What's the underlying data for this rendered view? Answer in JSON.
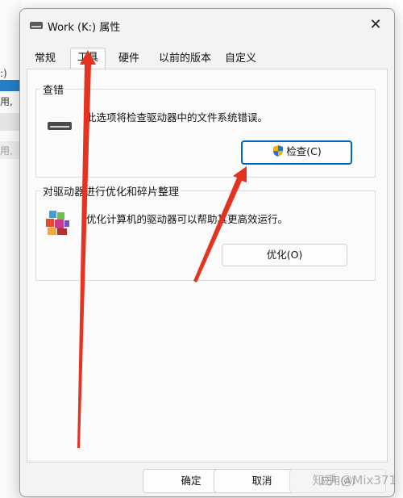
{
  "background": {
    "lines": [
      ":)",
      "用,",
      "用,"
    ]
  },
  "window": {
    "title": "Work (K:) 属性",
    "close_glyph": "✕"
  },
  "tabs": [
    {
      "label": "常规"
    },
    {
      "label": "工具"
    },
    {
      "label": "硬件"
    },
    {
      "label": "以前的版本"
    },
    {
      "label": "自定义"
    }
  ],
  "error_check": {
    "title": "查错",
    "description": "此选项将检查驱动器中的文件系统错误。",
    "button": "检查(C)",
    "icon": "hard-drive-icon",
    "button_icon": "uac-shield-icon"
  },
  "optimize": {
    "title": "对驱动器进行优化和碎片整理",
    "description": "优化计算机的驱动器可以帮助其更高效运行。",
    "button": "优化(O)",
    "icon": "defrag-icon"
  },
  "footer": {
    "ok": "确定",
    "cancel": "取消",
    "apply": "应用(A)"
  },
  "watermark": "知乎 @Mix371",
  "colors": {
    "accent": "#0067c0",
    "annotation_arrow": "#e53321"
  }
}
